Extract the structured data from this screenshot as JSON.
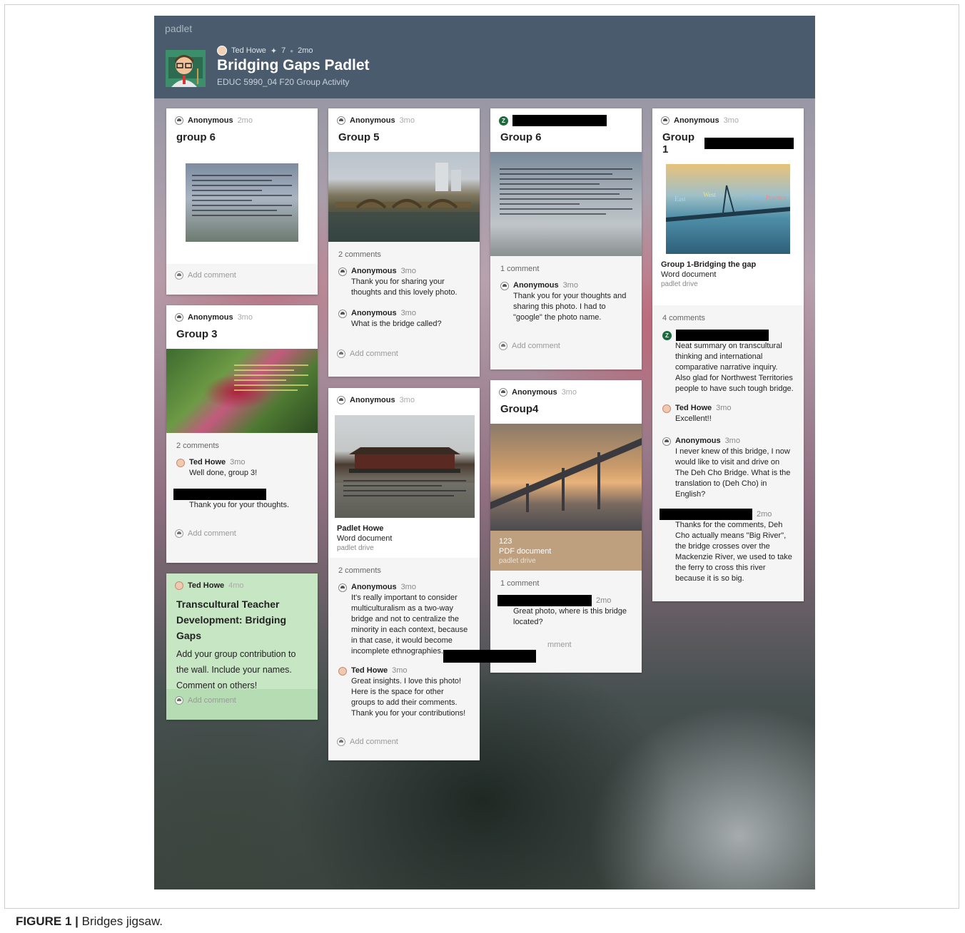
{
  "app": {
    "brand": "padlet",
    "owner": "Ted Howe",
    "likes": "7",
    "age": "2mo",
    "title": "Bridging Gaps Padlet",
    "subtitle": "EDUC 5990_04 F20 Group Activity",
    "like_symbol": "✦",
    "dot_symbol": "●"
  },
  "caption": {
    "label": "FIGURE 1 |",
    "text": "Bridges jigsaw."
  },
  "common": {
    "add_comment": "Add comment"
  },
  "posts": {
    "group6a": {
      "author": "Anonymous",
      "time": "2mo",
      "title": "group 6"
    },
    "group3": {
      "author": "Anonymous",
      "time": "3mo",
      "title": "Group 3",
      "comments_count": "2 comments",
      "c1": {
        "author": "Ted Howe",
        "time": "3mo",
        "text": "Well done, group 3!"
      },
      "c2": {
        "text": "Thank you for your thoughts."
      }
    },
    "intro": {
      "author": "Ted Howe",
      "time": "4mo",
      "title": "Transcultural Teacher Development: Bridging Gaps",
      "body": "Add your group contribution to the wall. Include your names. Comment on others!"
    },
    "group5": {
      "author": "Anonymous",
      "time": "3mo",
      "title": "Group 5",
      "comments_count": "2 comments",
      "c1": {
        "author": "Anonymous",
        "time": "3mo",
        "text": "Thank you for sharing your thoughts and this lovely photo."
      },
      "c2": {
        "author": "Anonymous",
        "time": "3mo",
        "text": "What is the bridge called?"
      }
    },
    "padlethowe": {
      "author": "Anonymous",
      "time": "3mo",
      "att_title": "Padlet Howe",
      "att_type": "Word document",
      "att_src": "padlet drive",
      "comments_count": "2 comments",
      "c1": {
        "author": "Anonymous",
        "time": "3mo",
        "text": "It's really important to consider multiculturalism as a two-way bridge and not to centralize the minority in each context, because in that case, it would become incomplete ethnographies."
      },
      "c2": {
        "author": "Ted Howe",
        "time": "3mo",
        "text": "Great insights. I love this photo! Here is the space for other groups to add their comments. Thank you for your contributions!"
      }
    },
    "group6b": {
      "avatar_letter": "Z",
      "title": "Group 6",
      "comments_count": "1 comment",
      "c1": {
        "author": "Anonymous",
        "time": "3mo",
        "text": "Thank you for your thoughts and sharing this photo. I had to \"google\" the photo name."
      }
    },
    "group4": {
      "author": "Anonymous",
      "time": "3mo",
      "title": "Group4",
      "att_title": "123",
      "att_type": "PDF document",
      "att_src": "padlet drive",
      "comments_count": "1 comment",
      "c1": {
        "time": "2mo",
        "text": "Great photo, where is this bridge located?"
      },
      "add_fragment": "mment"
    },
    "group1": {
      "author": "Anonymous",
      "time": "3mo",
      "title": "Group 1",
      "image_words": [
        "East",
        "West",
        "Theory",
        "Practice"
      ],
      "att_title": "Group 1-Bridging the gap",
      "att_type": "Word document",
      "att_src": "padlet drive",
      "comments_count": "4 comments",
      "c1": {
        "avatar_letter": "Z",
        "text": "Neat summary on transcultural thinking and international comparative narrative inquiry. Also glad for Northwest Territories people to have such tough bridge."
      },
      "c2": {
        "author": "Ted Howe",
        "time": "3mo",
        "text": "Excellent!!"
      },
      "c3": {
        "author": "Anonymous",
        "time": "3mo",
        "text": "I never knew of this bridge, I now would like to visit and drive on The Deh Cho Bridge. What is the translation to (Deh Cho) in English?"
      },
      "c4": {
        "time": "2mo",
        "text": "Thanks for the comments, Deh Cho actually means \"Big River\", the bridge crosses over the Mackenzie River, we used to take the ferry to cross this river because it is so big."
      }
    }
  }
}
